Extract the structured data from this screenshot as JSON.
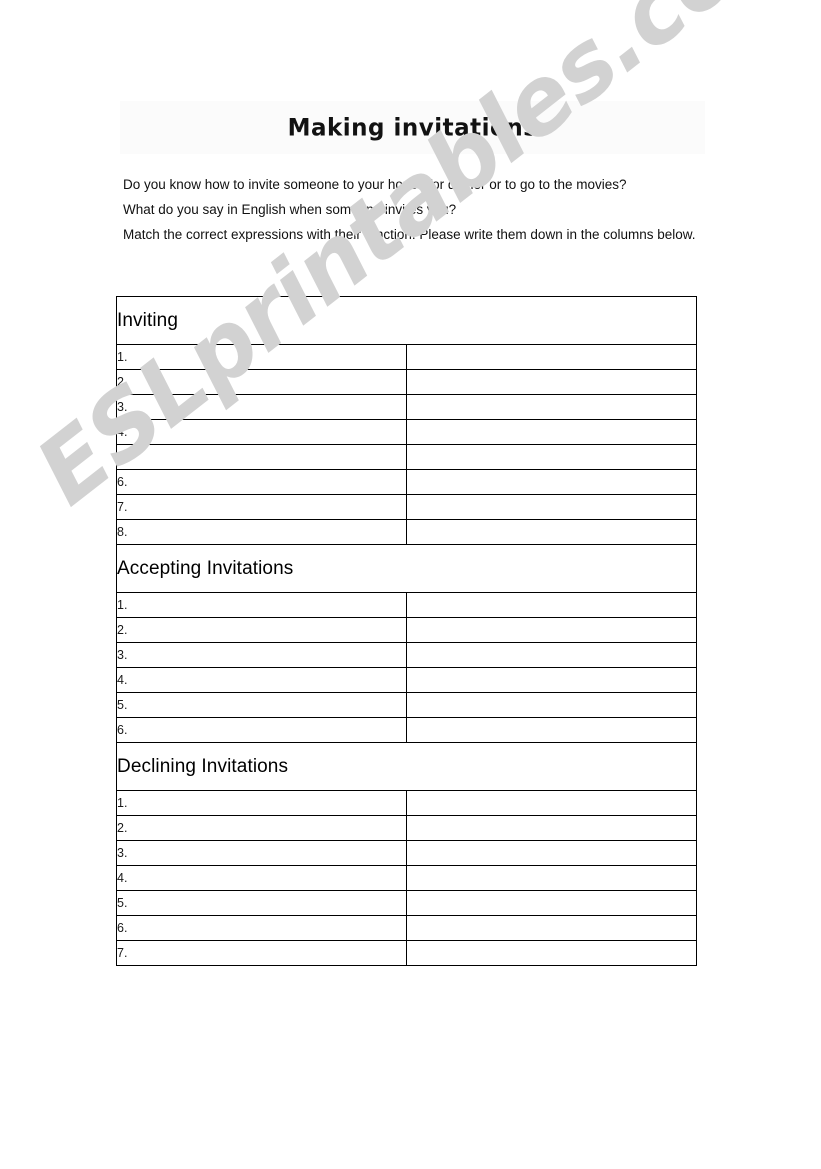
{
  "document": {
    "title": "Making invitations",
    "watermark": "ESLprintables.com",
    "watermark_color": "#d2d2d2",
    "banner_color": "#fbfbfb",
    "page_background": "#ffffff",
    "text_color": "#000000"
  },
  "intro": {
    "lines": [
      "Do you know how to invite someone to your house for dinner or to go to the movies?",
      "What do you say in English when someone invites you?",
      "Match the correct expressions with their function. Please write them down in the columns below."
    ]
  },
  "table": {
    "sections": [
      {
        "header": "Inviting",
        "rows": [
          {
            "number": "1.",
            "answer": ""
          },
          {
            "number": "2.",
            "answer": ""
          },
          {
            "number": "3.",
            "answer": ""
          },
          {
            "number": "4.",
            "answer": ""
          },
          {
            "number": "5.",
            "answer": ""
          },
          {
            "number": "6.",
            "answer": ""
          },
          {
            "number": "7.",
            "answer": ""
          },
          {
            "number": "8.",
            "answer": ""
          }
        ]
      },
      {
        "header": "Accepting Invitations",
        "rows": [
          {
            "number": "1.",
            "answer": ""
          },
          {
            "number": "2.",
            "answer": ""
          },
          {
            "number": "3.",
            "answer": ""
          },
          {
            "number": "4.",
            "answer": ""
          },
          {
            "number": "5.",
            "answer": ""
          },
          {
            "number": "6.",
            "answer": ""
          }
        ]
      },
      {
        "header": "Declining Invitations",
        "rows": [
          {
            "number": "1.",
            "answer": ""
          },
          {
            "number": "2.",
            "answer": ""
          },
          {
            "number": "3.",
            "answer": ""
          },
          {
            "number": "4.",
            "answer": ""
          },
          {
            "number": "5.",
            "answer": ""
          },
          {
            "number": "6.",
            "answer": ""
          },
          {
            "number": "7.",
            "answer": ""
          }
        ]
      }
    ]
  }
}
